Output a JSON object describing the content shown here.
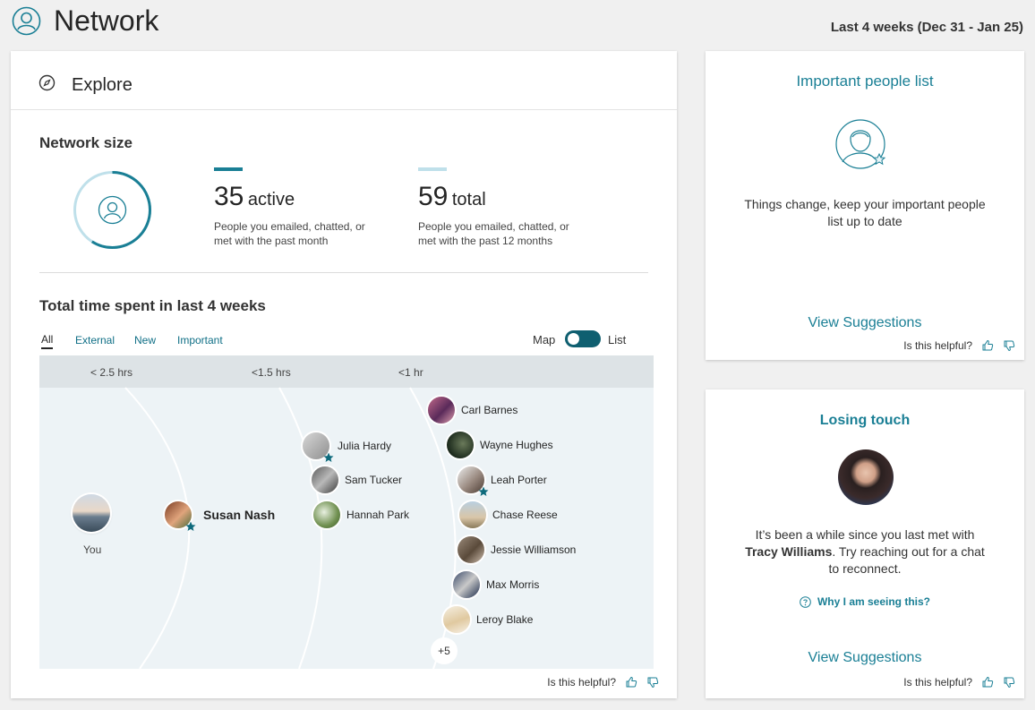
{
  "header": {
    "title": "Network",
    "date_range": "Last 4 weeks (Dec 31 - Jan 25)"
  },
  "explore": {
    "title": "Explore"
  },
  "network_size": {
    "title": "Network size",
    "active": {
      "count": "35",
      "label": "active",
      "desc": "People you emailed, chatted, or met with the past month"
    },
    "total": {
      "count": "59",
      "label": "total",
      "desc": "People you emailed, chatted, or met with the past 12 months"
    },
    "active_fraction": 0.59
  },
  "time_spent": {
    "title": "Total time spent in last 4 weeks",
    "tabs": [
      "All",
      "External",
      "New",
      "Important"
    ],
    "toggle": {
      "left": "Map",
      "right": "List"
    },
    "bands": [
      "< 2.5 hrs",
      "<1.5 hrs",
      "<1 hr"
    ],
    "you_label": "You",
    "people": {
      "susan": "Susan Nash",
      "julia": "Julia Hardy",
      "sam": "Sam Tucker",
      "hannah": "Hannah Park",
      "carl": "Carl Barnes",
      "wayne": "Wayne Hughes",
      "leah": "Leah Porter",
      "chase": "Chase Reese",
      "jessie": "Jessie Williamson",
      "max": "Max Morris",
      "leroy": "Leroy Blake"
    },
    "more": "+5",
    "helpful": "Is this helpful?"
  },
  "important_people": {
    "title": "Important people list",
    "desc": "Things change, keep your important people list up to date",
    "action": "View Suggestions",
    "helpful": "Is this helpful?"
  },
  "losing_touch": {
    "title": "Losing touch",
    "desc_pre": "It’s been a while since you last met with",
    "name": "Tracy Williams",
    "desc_post": ". Try reaching out for a chat to reconnect.",
    "why": "Why I am seeing this?",
    "action": "View Suggestions",
    "helpful": "Is this helpful?"
  },
  "colors": {
    "accent": "#1a7f95",
    "star": "#0e6a7c",
    "map_bg": "#edf3f6",
    "band_bg": "#dde3e6"
  }
}
